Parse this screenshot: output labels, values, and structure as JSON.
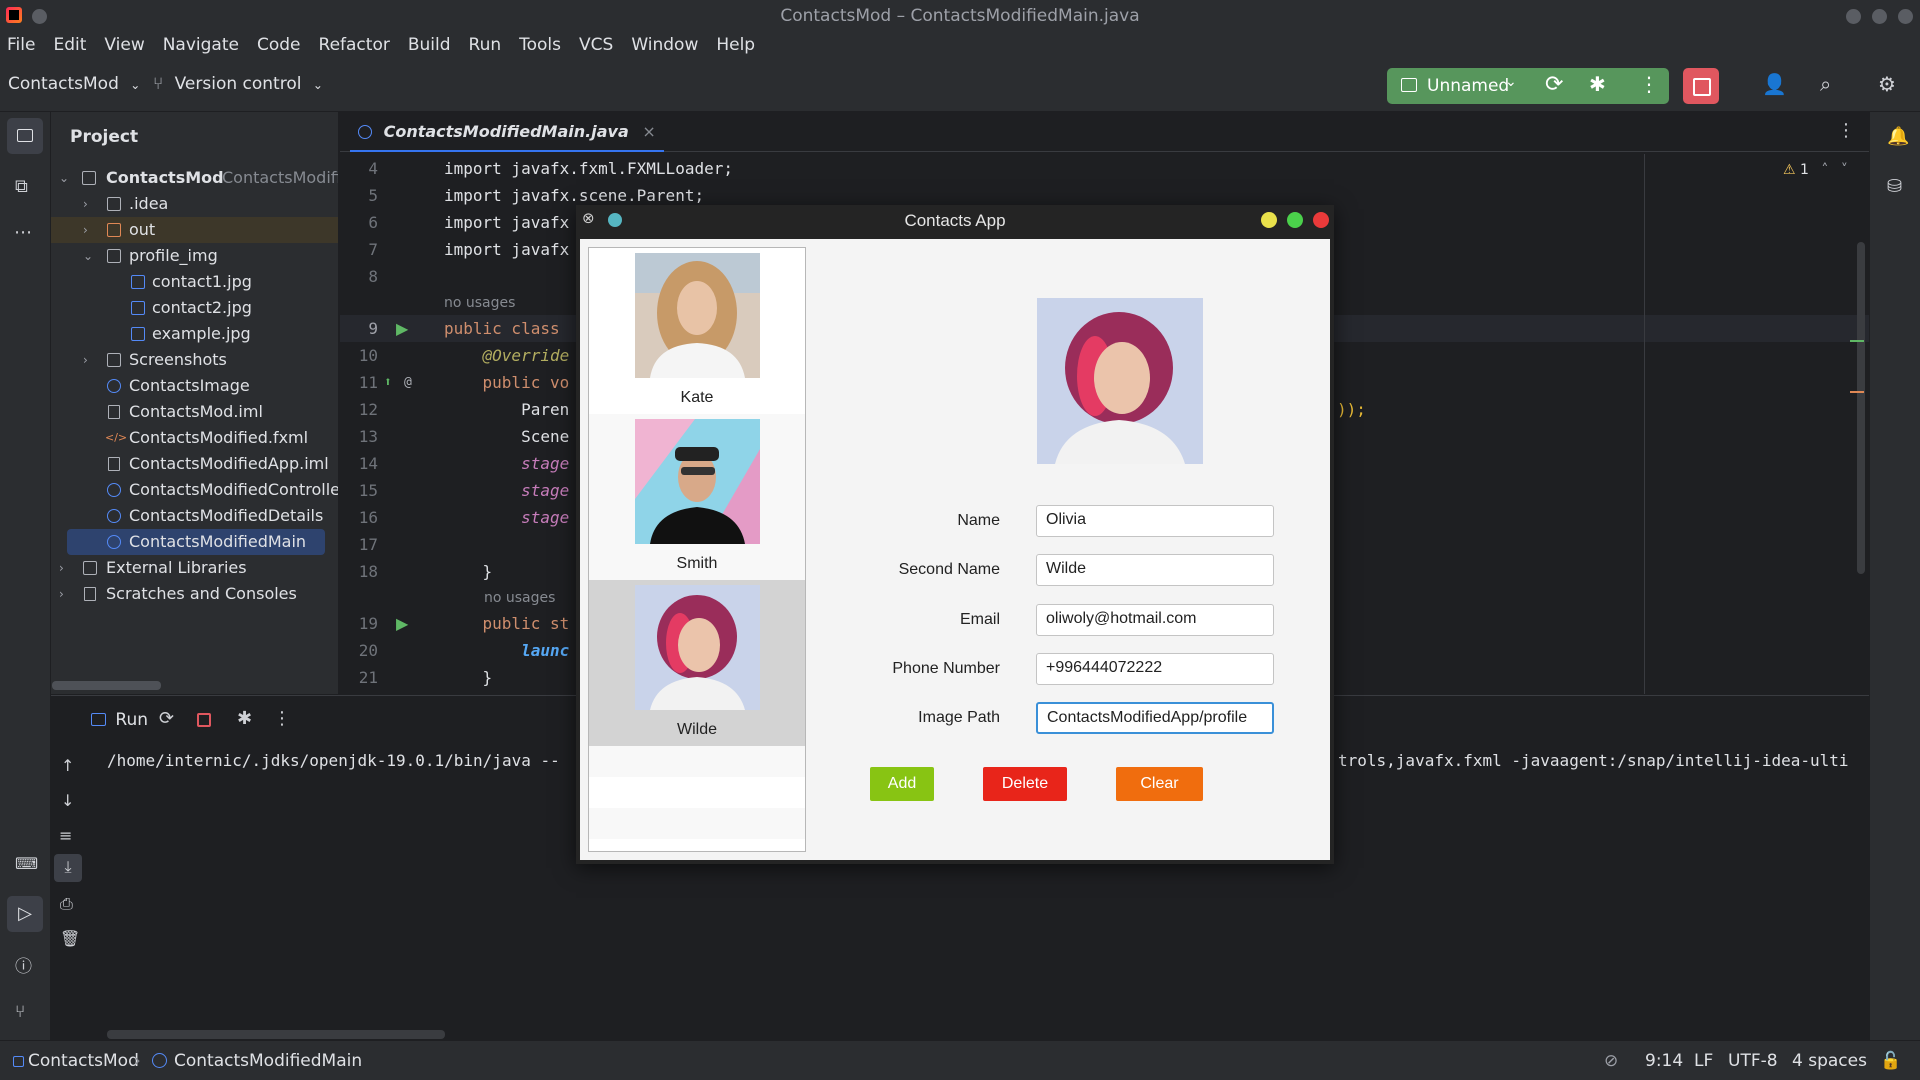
{
  "window": {
    "title": "ContactsMod – ContactsModifiedMain.java"
  },
  "menu": [
    "File",
    "Edit",
    "View",
    "Navigate",
    "Code",
    "Refactor",
    "Build",
    "Run",
    "Tools",
    "VCS",
    "Window",
    "Help"
  ],
  "toolbar": {
    "project_name": "ContactsMod",
    "vcs_label": "Version control",
    "run_config": "Unnamed"
  },
  "project_panel": {
    "title": "Project",
    "root": {
      "name": "ContactsMod",
      "hint": "ContactsModifie"
    },
    "items": [
      {
        "label": ".idea"
      },
      {
        "label": "out"
      },
      {
        "label": "profile_img"
      },
      {
        "label": "contact1.jpg"
      },
      {
        "label": "contact2.jpg"
      },
      {
        "label": "example.jpg"
      },
      {
        "label": "Screenshots"
      },
      {
        "label": "ContactsImage"
      },
      {
        "label": "ContactsMod.iml"
      },
      {
        "label": "ContactsModified.fxml"
      },
      {
        "label": "ContactsModifiedApp.iml"
      },
      {
        "label": "ContactsModifiedController"
      },
      {
        "label": "ContactsModifiedDetails"
      },
      {
        "label": "ContactsModifiedMain"
      },
      {
        "label": "External Libraries"
      },
      {
        "label": "Scratches and Consoles"
      }
    ]
  },
  "editor": {
    "tab": "ContactsModifiedMain.java",
    "warnings": "1",
    "usage_hint": "no usages",
    "lines": [
      {
        "n": "4",
        "code": "import javafx.fxml.FXMLLoader;"
      },
      {
        "n": "5",
        "code": "import javafx.scene.Parent;"
      },
      {
        "n": "6",
        "code": "import javafx"
      },
      {
        "n": "7",
        "code": "import javafx"
      },
      {
        "n": "8",
        "code": ""
      },
      {
        "n": "9",
        "code": "public class"
      },
      {
        "n": "10",
        "code": "    @Override"
      },
      {
        "n": "11",
        "code": "    public vo"
      },
      {
        "n": "12",
        "code": "        Paren"
      },
      {
        "n": "13",
        "code": "        Scene"
      },
      {
        "n": "14",
        "code": "        stage"
      },
      {
        "n": "15",
        "code": "        stage"
      },
      {
        "n": "16",
        "code": "        stage"
      },
      {
        "n": "17",
        "code": ""
      },
      {
        "n": "18",
        "code": "    }"
      },
      {
        "n": "19",
        "code": "    public st"
      },
      {
        "n": "20",
        "code": "        launc"
      },
      {
        "n": "21",
        "code": "    }"
      }
    ],
    "right_fragment": "));"
  },
  "run_panel": {
    "tab": "Run",
    "command_left": "/home/internic/.jdks/openjdk-19.0.1/bin/java --",
    "command_right": "trols,javafx.fxml -javaagent:/snap/intellij-idea-ulti"
  },
  "status": {
    "breadcrumb_project": "ContactsMod",
    "breadcrumb_file": "ContactsModifiedMain",
    "position": "9:14",
    "line_sep": "LF",
    "encoding": "UTF-8",
    "indent": "4 spaces"
  },
  "dialog": {
    "title": "Contacts App",
    "contacts": [
      {
        "name": "Kate"
      },
      {
        "name": "Smith"
      },
      {
        "name": "Wilde"
      }
    ],
    "form": {
      "name_label": "Name",
      "name_value": "Olivia",
      "second_name_label": "Second Name",
      "second_name_value": "Wilde",
      "email_label": "Email",
      "email_value": "oliwoly@hotmail.com",
      "phone_label": "Phone Number",
      "phone_value": "+996444072222",
      "image_label": "Image Path",
      "image_value": "ContactsModifiedApp/profile"
    },
    "buttons": {
      "add": "Add",
      "delete": "Delete",
      "clear": "Clear"
    },
    "colors": {
      "add": "#88c413",
      "delete": "#e8251a",
      "clear": "#f06d0e"
    }
  }
}
